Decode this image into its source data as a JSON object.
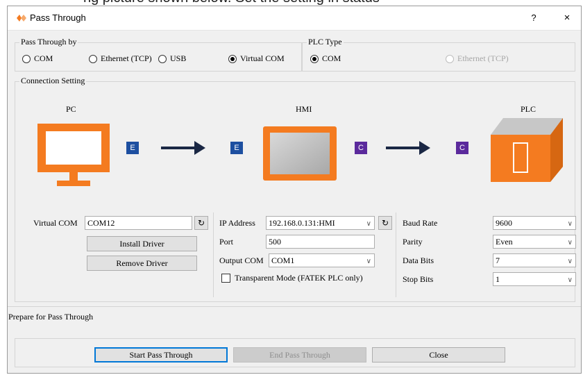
{
  "window": {
    "title": "Pass Through",
    "help": "?",
    "close": "×"
  },
  "top_crop_text": "ng picture shown below. Set the setting in status",
  "pass_through_by": {
    "label": "Pass Through by",
    "options": [
      "COM",
      "Ethernet (TCP)",
      "USB",
      "Virtual COM"
    ],
    "selected": "Virtual COM"
  },
  "plc_type": {
    "label": "PLC Type",
    "options": [
      "COM",
      "Ethernet (TCP)"
    ],
    "selected": "COM"
  },
  "connection": {
    "label": "Connection Setting",
    "pc_label": "PC",
    "hmi_label": "HMI",
    "plc_label": "PLC",
    "badge_e": "E",
    "badge_c": "C"
  },
  "virtual_com": {
    "label": "Virtual COM",
    "value": "COM12",
    "install": "Install Driver",
    "remove": "Remove Driver"
  },
  "network": {
    "ip_label": "IP Address",
    "ip_value": "192.168.0.131:HMI",
    "port_label": "Port",
    "port_value": "500",
    "output_label": "Output COM",
    "output_value": "COM1",
    "transparent_label": "Transparent Mode (FATEK PLC only)"
  },
  "serial": {
    "baud_label": "Baud Rate",
    "baud_value": "9600",
    "parity_label": "Parity",
    "parity_value": "Even",
    "data_label": "Data Bits",
    "data_value": "7",
    "stop_label": "Stop Bits",
    "stop_value": "1"
  },
  "status": "Prepare for Pass Through",
  "buttons": {
    "start": "Start Pass Through",
    "end": "End Pass Through",
    "close": "Close"
  },
  "colors": {
    "accent": "#0078d7",
    "orange": "#f47b20",
    "badge_e": "#1d4fa0",
    "badge_c": "#5b2a9c"
  },
  "icons": {
    "refresh": "↻",
    "chevron": "∨"
  }
}
